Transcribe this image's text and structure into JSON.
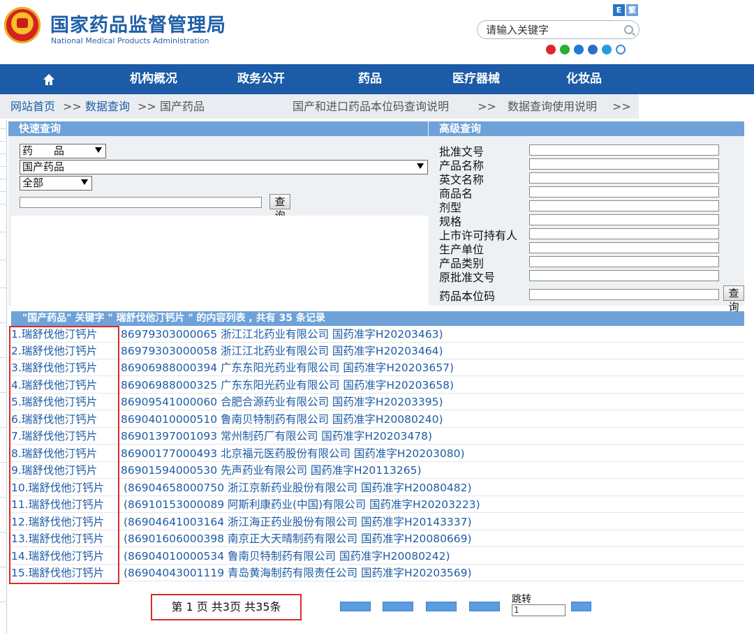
{
  "header": {
    "title": "国家药品监督管理局",
    "subtitle": "National Medical Products Administration",
    "search_placeholder": "请输入关键字"
  },
  "nav": {
    "items": [
      "机构概况",
      "政务公开",
      "药品",
      "医疗器械",
      "化妆品"
    ]
  },
  "breadcrumb": {
    "home": "网站首页",
    "sep": ">>",
    "data_query": "数据查询",
    "current": "国产药品",
    "link_code_help": "国产和进口药品本位码查询说明",
    "link_usage_help": "数据查询使用说明"
  },
  "quick_query": {
    "title": "快速查询",
    "category_value": "药　　品",
    "database_value": "国产药品",
    "scope_value": "全部",
    "keyword_value": "",
    "query_button": "查询"
  },
  "advanced_query": {
    "title": "高级查询",
    "fields": [
      "批准文号",
      "产品名称",
      "英文名称",
      "商品名",
      "剂型",
      "规格",
      "上市许可持有人",
      "生产单位",
      "产品类别",
      "原批准文号",
      "药品本位码"
    ],
    "query_button": "查询"
  },
  "results": {
    "header": "\"国产药品\" 关键字 \" 瑞舒伐他汀钙片 \" 的内容列表 , 共有 35 条记录",
    "rows": [
      {
        "name": "1.瑞舒伐他汀钙片",
        "info": "86979303000065 浙江江北药业有限公司 国药准字H20203463)"
      },
      {
        "name": "2.瑞舒伐他汀钙片",
        "info": "86979303000058 浙江江北药业有限公司 国药准字H20203464)"
      },
      {
        "name": "3.瑞舒伐他汀钙片",
        "info": "86906988000394 广东东阳光药业有限公司 国药准字H20203657)"
      },
      {
        "name": "4.瑞舒伐他汀钙片",
        "info": "86906988000325 广东东阳光药业有限公司 国药准字H20203658)"
      },
      {
        "name": "5.瑞舒伐他汀钙片",
        "info": "86909541000060 合肥合源药业有限公司 国药准字H20203395)"
      },
      {
        "name": "6.瑞舒伐他汀钙片",
        "info": "86904010000510 鲁南贝特制药有限公司 国药准字H20080240)"
      },
      {
        "name": "7.瑞舒伐他汀钙片",
        "info": "86901397001093 常州制药厂有限公司 国药准字H20203478)"
      },
      {
        "name": "8.瑞舒伐他汀钙片",
        "info": "86900177000493 北京福元医药股份有限公司 国药准字H20203080)"
      },
      {
        "name": "9.瑞舒伐他汀钙片",
        "info": "86901594000530 先声药业有限公司 国药准字H20113265)"
      },
      {
        "name": "10.瑞舒伐他汀钙片",
        "info": "(86904658000750 浙江京新药业股份有限公司 国药准字H20080482)"
      },
      {
        "name": "11.瑞舒伐他汀钙片",
        "info": "(86910153000089 阿斯利康药业(中国)有限公司 国药准字H20203223)"
      },
      {
        "name": "12.瑞舒伐他汀钙片",
        "info": "(86904641003164 浙江海正药业股份有限公司 国药准字H20143337)"
      },
      {
        "name": "13.瑞舒伐他汀钙片",
        "info": "(86901606000398 南京正大天晴制药有限公司 国药准字H20080669)"
      },
      {
        "name": "14.瑞舒伐他汀钙片",
        "info": "(86904010000534 鲁南贝特制药有限公司 国药准字H20080242)"
      },
      {
        "name": "15.瑞舒伐他汀钙片",
        "info": "(86904043001119 青岛黄海制药有限责任公司 国药准字H20203569)"
      }
    ]
  },
  "pager": {
    "summary": "第 1 页 共3页 共35条",
    "jump_label": "跳转",
    "jump_value": "1"
  },
  "colors": {
    "primary": "#1b5ba7",
    "panel_header": "#6ea2d9",
    "link": "#1d5ca5",
    "highlight": "#d92b2b"
  }
}
